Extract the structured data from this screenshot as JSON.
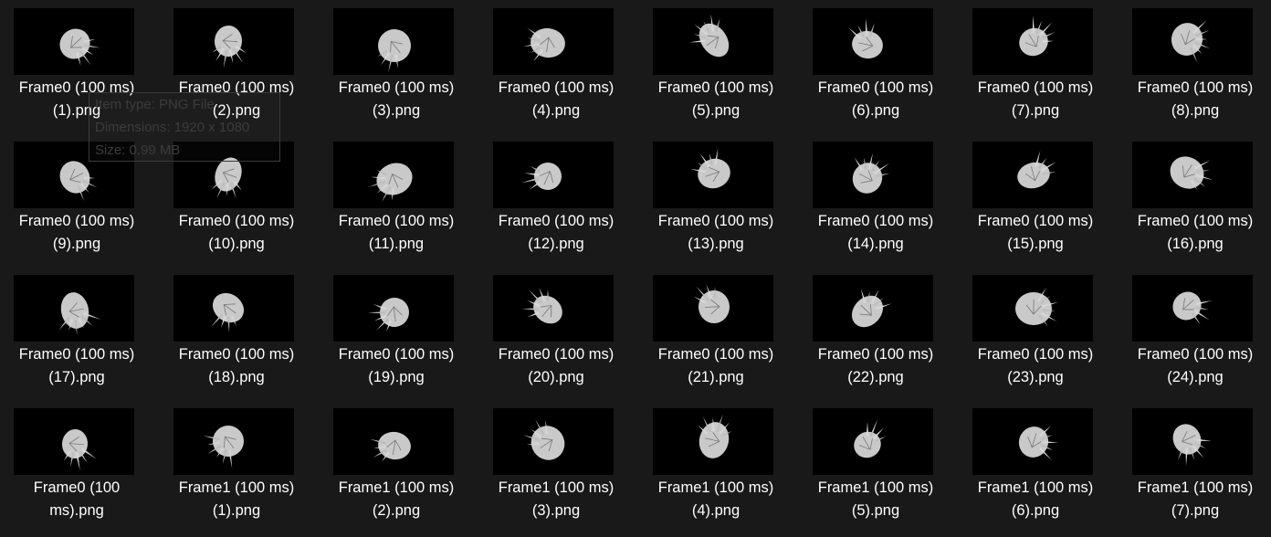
{
  "tooltip": {
    "type_text": "Item type: PNG File",
    "dimensions_text": "Dimensions: 1920 x 1080",
    "size_text": "Size: 0.99 MB"
  },
  "files": [
    {
      "line1": "Frame0 (100 ms)",
      "line2": "(1).png"
    },
    {
      "line1": "Frame0 (100 ms)",
      "line2": "(2).png"
    },
    {
      "line1": "Frame0 (100 ms)",
      "line2": "(3).png"
    },
    {
      "line1": "Frame0 (100 ms)",
      "line2": "(4).png"
    },
    {
      "line1": "Frame0 (100 ms)",
      "line2": "(5).png"
    },
    {
      "line1": "Frame0 (100 ms)",
      "line2": "(6).png"
    },
    {
      "line1": "Frame0 (100 ms)",
      "line2": "(7).png"
    },
    {
      "line1": "Frame0 (100 ms)",
      "line2": "(8).png"
    },
    {
      "line1": "Frame0 (100 ms)",
      "line2": "(9).png"
    },
    {
      "line1": "Frame0 (100 ms)",
      "line2": "(10).png"
    },
    {
      "line1": "Frame0 (100 ms)",
      "line2": "(11).png"
    },
    {
      "line1": "Frame0 (100 ms)",
      "line2": "(12).png"
    },
    {
      "line1": "Frame0 (100 ms)",
      "line2": "(13).png"
    },
    {
      "line1": "Frame0 (100 ms)",
      "line2": "(14).png"
    },
    {
      "line1": "Frame0 (100 ms)",
      "line2": "(15).png"
    },
    {
      "line1": "Frame0 (100 ms)",
      "line2": "(16).png"
    },
    {
      "line1": "Frame0 (100 ms)",
      "line2": "(17).png"
    },
    {
      "line1": "Frame0 (100 ms)",
      "line2": "(18).png"
    },
    {
      "line1": "Frame0 (100 ms)",
      "line2": "(19).png"
    },
    {
      "line1": "Frame0 (100 ms)",
      "line2": "(20).png"
    },
    {
      "line1": "Frame0 (100 ms)",
      "line2": "(21).png"
    },
    {
      "line1": "Frame0 (100 ms)",
      "line2": "(22).png"
    },
    {
      "line1": "Frame0 (100 ms)",
      "line2": "(23).png"
    },
    {
      "line1": "Frame0 (100 ms)",
      "line2": "(24).png"
    },
    {
      "line1": "Frame0 (100",
      "line2": "ms).png"
    },
    {
      "line1": "Frame1 (100 ms)",
      "line2": "(1).png"
    },
    {
      "line1": "Frame1 (100 ms)",
      "line2": "(2).png"
    },
    {
      "line1": "Frame1 (100 ms)",
      "line2": "(3).png"
    },
    {
      "line1": "Frame1 (100 ms)",
      "line2": "(4).png"
    },
    {
      "line1": "Frame1 (100 ms)",
      "line2": "(5).png"
    },
    {
      "line1": "Frame1 (100 ms)",
      "line2": "(6).png"
    },
    {
      "line1": "Frame1 (100 ms)",
      "line2": "(7).png"
    }
  ]
}
